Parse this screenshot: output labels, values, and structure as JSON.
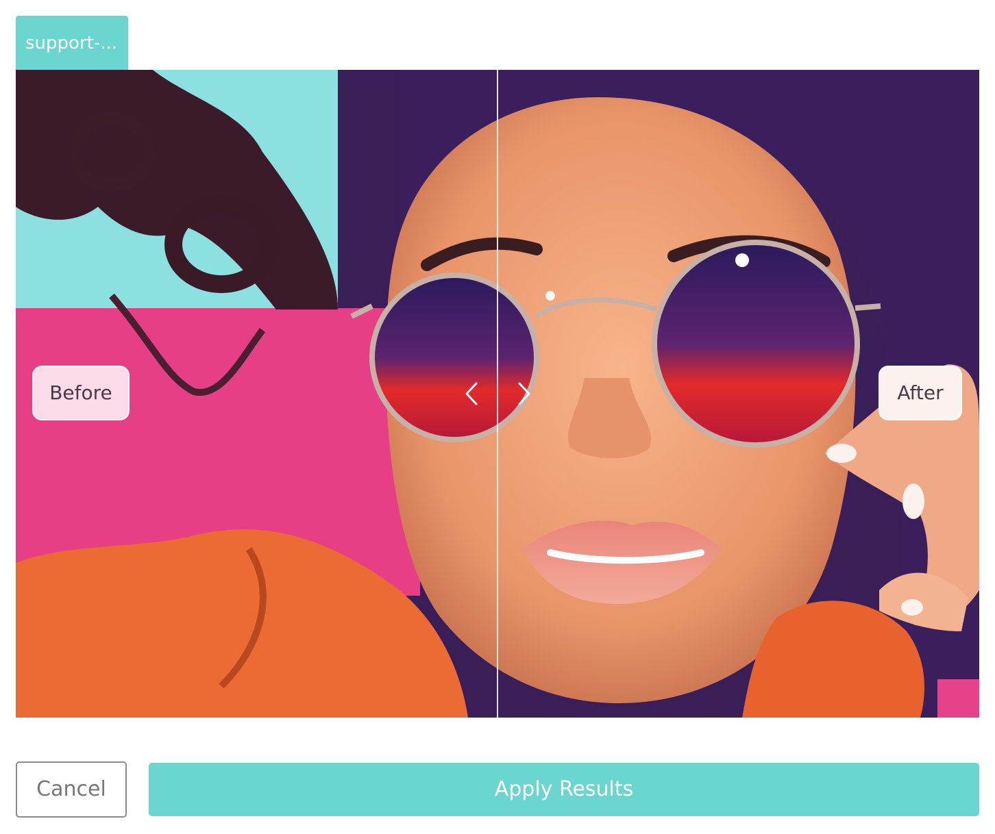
{
  "tab": {
    "label": "support-..."
  },
  "comparison": {
    "before_label": "Before",
    "after_label": "After",
    "split_fraction": 0.5,
    "prev_icon": "chevron-left-icon",
    "next_icon": "chevron-right-icon"
  },
  "actions": {
    "cancel_label": "Cancel",
    "apply_label": "Apply Results"
  },
  "colors": {
    "accent": "#6bd6cf",
    "before_pill_bg": "#fbdbe8",
    "after_pill_bg": "#fbf2ee",
    "cancel_border": "#8a8a8a"
  }
}
